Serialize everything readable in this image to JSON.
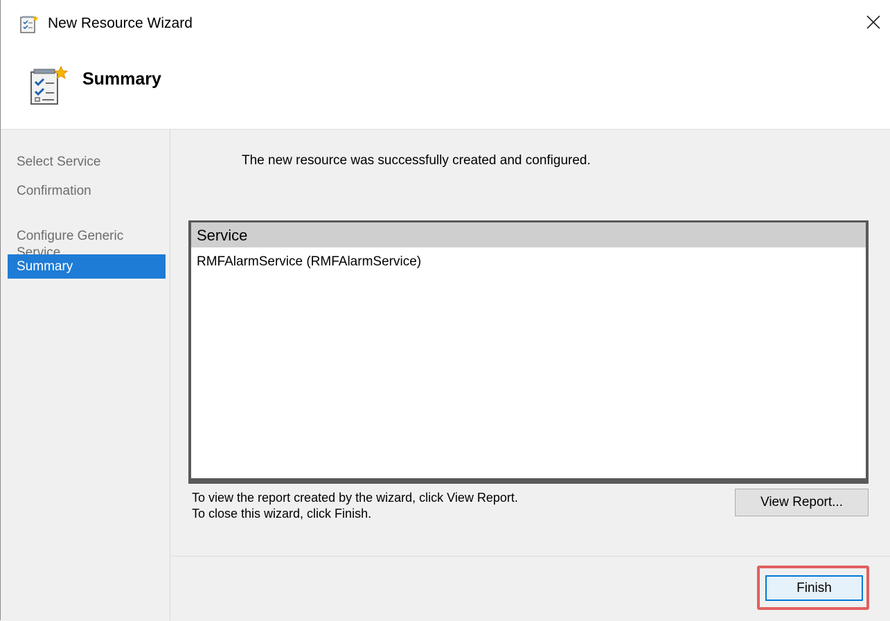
{
  "window": {
    "title": "New Resource Wizard",
    "close_glyph": "✕"
  },
  "header": {
    "title": "Summary",
    "icon": "wizard-checklist-icon"
  },
  "sidebar": {
    "steps": [
      {
        "label": "Select Service",
        "active": false
      },
      {
        "label": "Confirmation",
        "active": false
      },
      {
        "label": "Configure Generic\nService",
        "active": false
      },
      {
        "label": "Summary",
        "active": true
      }
    ]
  },
  "main": {
    "message": "The new resource was successfully created and configured.",
    "list": {
      "column_header": "Service",
      "rows": [
        "RMFAlarmService (RMFAlarmService)"
      ]
    },
    "instructions": {
      "line1": "To view the report created by the wizard, click View Report.",
      "line2": "To close this wizard, click Finish."
    },
    "view_report_label": "View Report...",
    "finish_label": "Finish"
  },
  "colors": {
    "accent": "#1e7cd6",
    "highlight": "#e06060",
    "focus_border": "#0078d7"
  }
}
